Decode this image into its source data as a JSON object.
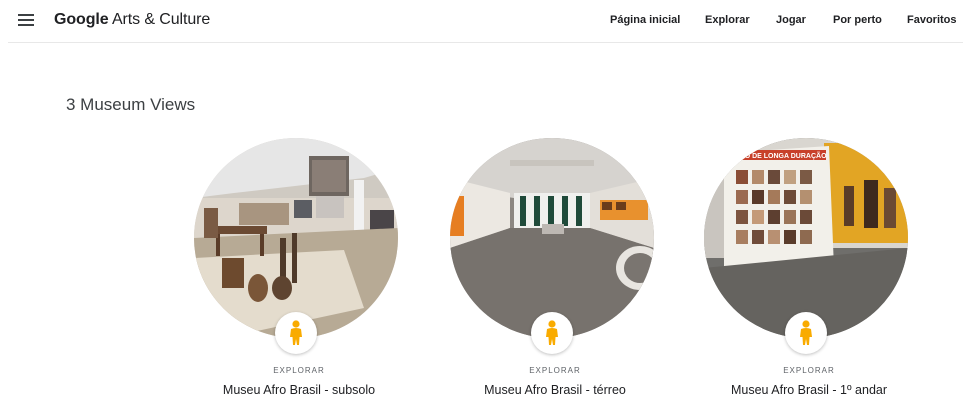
{
  "header": {
    "logo_brand": "Google",
    "logo_rest": " Arts & Culture",
    "nav": [
      "Página inicial",
      "Explorar",
      "Jogar",
      "Por perto",
      "Favoritos"
    ]
  },
  "section": {
    "title": "3 Museum Views"
  },
  "cards": [
    {
      "kicker": "EXPLORAR",
      "title": "Museu Afro Brasil - subsolo"
    },
    {
      "kicker": "EXPLORAR",
      "title": "Museu Afro Brasil - térreo"
    },
    {
      "kicker": "EXPLORAR",
      "title": "Museu Afro Brasil - 1º andar"
    }
  ],
  "banner_text": "SIÇÃO DE LONGA DURAÇÃO",
  "colors": {
    "pegman": "#f9ab00",
    "text_primary": "#202124",
    "text_secondary": "#5f6368"
  }
}
